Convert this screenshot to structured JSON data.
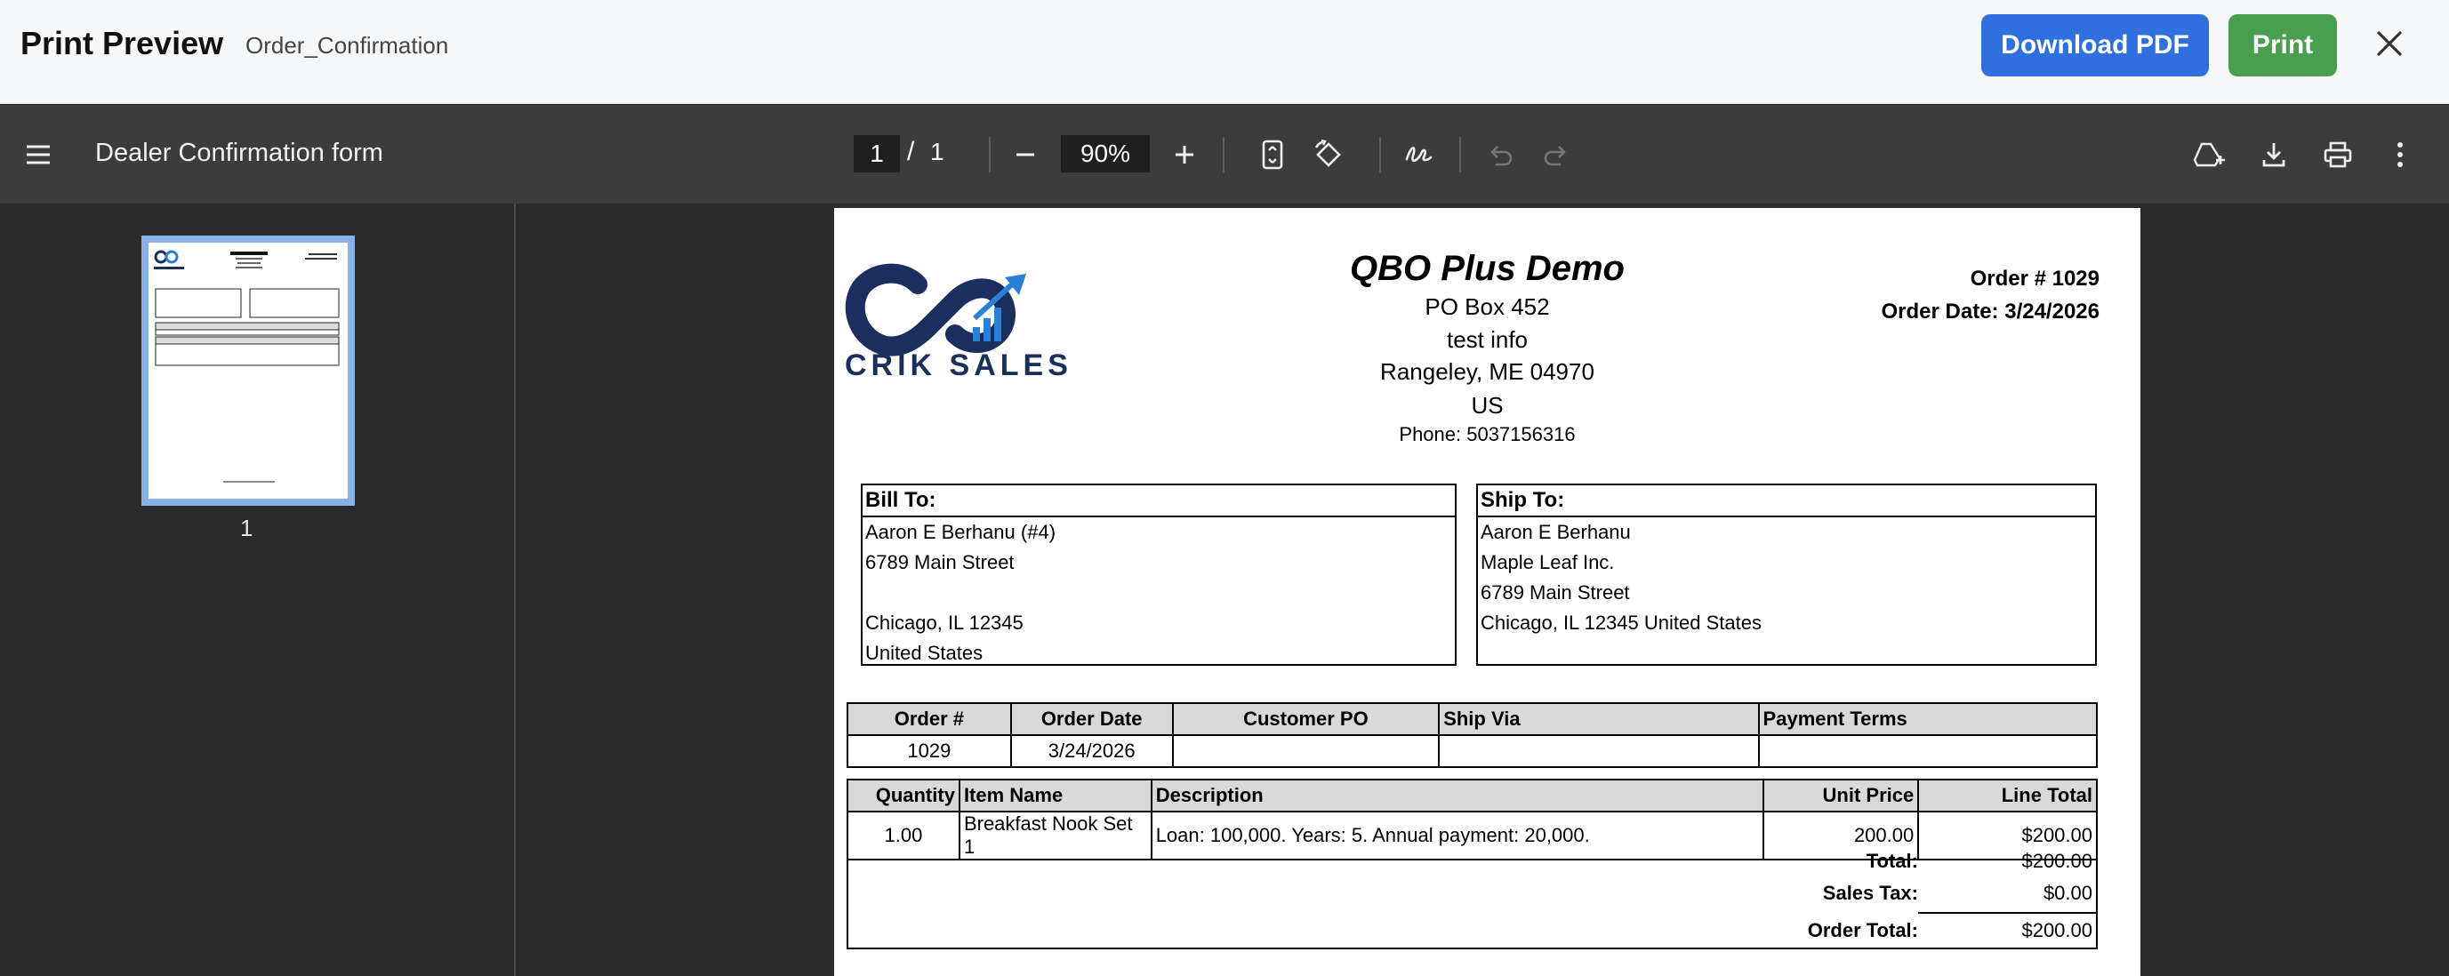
{
  "header": {
    "title": "Print Preview",
    "document_name": "Order_Confirmation",
    "download_label": "Download PDF",
    "print_label": "Print"
  },
  "viewer": {
    "title": "Dealer Confirmation form",
    "current_page": "1",
    "page_separator": "/",
    "total_pages": "1",
    "zoom": "90%"
  },
  "thumbnails": [
    {
      "label": "1"
    }
  ],
  "document": {
    "company": {
      "name": "QBO Plus Demo",
      "line1": "PO Box 452",
      "line2": "test info",
      "line3": "Rangeley, ME   04970",
      "line4": "US",
      "phone": "Phone: 5037156316",
      "logo_text": "CRIK SALES"
    },
    "order_number": "Order # 1029",
    "order_date": "Order Date: 3/24/2026",
    "bill_to": {
      "heading": "Bill To:",
      "lines": [
        "Aaron E Berhanu (#4)",
        "6789 Main Street",
        "",
        "Chicago, IL  12345",
        "United States"
      ]
    },
    "ship_to": {
      "heading": "Ship To:",
      "lines": [
        "Aaron E Berhanu",
        "Maple Leaf Inc.",
        "6789 Main Street",
        "Chicago, IL  12345 United States"
      ]
    },
    "order_table": {
      "headers": [
        "Order #",
        "Order Date",
        "Customer PO",
        "Ship Via",
        "Payment Terms"
      ],
      "row": [
        "1029",
        "3/24/2026",
        "",
        "",
        ""
      ]
    },
    "items_table": {
      "headers": [
        "Quantity",
        "Item Name",
        "Description",
        "Unit Price",
        "Line Total"
      ],
      "rows": [
        [
          "1.00",
          "Breakfast Nook Set 1",
          "Loan: 100,000. Years: 5. Annual payment: 20,000.",
          "200.00",
          "$200.00"
        ]
      ]
    },
    "totals": {
      "total_label": "Total:",
      "total_value": "$200.00",
      "tax_label": "Sales Tax:",
      "tax_value": "$0.00",
      "order_total_label": "Order Total:",
      "order_total_value": "$200.00"
    }
  },
  "colors": {
    "download_button": "#2f6fde",
    "print_button": "#4a9e50",
    "toolbar": "#3c3c3c",
    "viewer_bg": "#2b2b2b",
    "logo_navy": "#1b2f5e",
    "logo_blue": "#2b7fd6"
  }
}
